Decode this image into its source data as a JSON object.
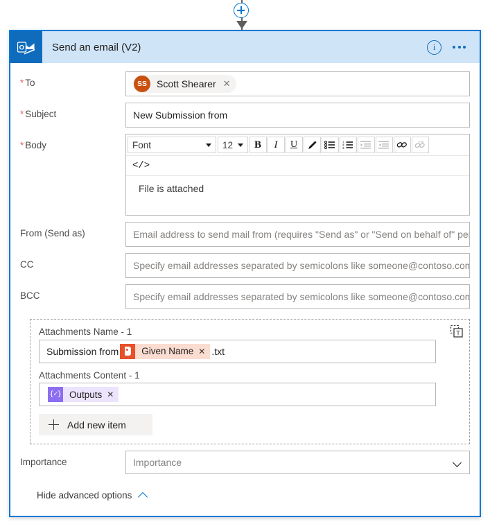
{
  "connector": {
    "add_step_icon": "plus-circle-icon",
    "arrow_icon": "arrow-down-icon"
  },
  "card": {
    "title": "Send an email (V2)",
    "app_icon": "outlook-icon",
    "info_icon": "i",
    "info_icon_name": "info-icon",
    "more_icon_name": "ellipsis-icon",
    "accent_color": "#0078d4",
    "header_bg": "#cfe4f7"
  },
  "fields": {
    "to": {
      "label": "To",
      "required": true,
      "person": {
        "initials": "SS",
        "name": "Scott Shearer",
        "avatar_color": "#ca5010",
        "remove_icon": "✕"
      }
    },
    "subject": {
      "label": "Subject",
      "required": true,
      "value": "New Submission from"
    },
    "body": {
      "label": "Body",
      "required": true,
      "content": "File is attached",
      "toolbar": {
        "font_label": "Font",
        "size_label": "12",
        "bold": "B",
        "italic": "I",
        "underline": "U",
        "text_color_icon": "pen-icon",
        "bulleted_list_icon": "bulleted-list-icon",
        "numbered_list_icon": "numbered-list-icon",
        "indent_decrease_icon": "indent-decrease-icon",
        "indent_increase_icon": "indent-increase-icon",
        "link_icon": "link-icon",
        "unlink_icon": "unlink-icon",
        "code_view": "</>"
      }
    },
    "from": {
      "label": "From (Send as)",
      "required": false,
      "placeholder": "Email address to send mail from (requires \"Send as\" or \"Send on behalf of\" permissions)"
    },
    "cc": {
      "label": "CC",
      "required": false,
      "placeholder": "Specify email addresses separated by semicolons like someone@contoso.com"
    },
    "bcc": {
      "label": "BCC",
      "required": false,
      "placeholder": "Specify email addresses separated by semicolons like someone@contoso.com"
    },
    "importance": {
      "label": "Importance",
      "placeholder": "Importance",
      "chevron_icon": "chevron-down-icon"
    }
  },
  "attachments": {
    "name_label": "Attachments Name - 1",
    "name_prefix": "Submission from",
    "name_token": {
      "label": "Given Name",
      "icon": "forms-icon",
      "icon_color": "#e8502a",
      "chip_color": "#fbdcd0",
      "remove_icon": "✕"
    },
    "name_suffix": ".txt",
    "content_label": "Attachments Content - 1",
    "content_token": {
      "label": "Outputs",
      "icon": "expression-icon",
      "icon_glyph": "{✓}",
      "icon_color": "#8c6ff0",
      "chip_color": "#ece4fd",
      "remove_icon": "✕"
    },
    "add_new_item_label": "Add new item",
    "delete_item_icon": "delete-item-icon"
  },
  "footer": {
    "advanced_options_label": "Hide advanced options",
    "chevron_icon": "chevron-up-icon"
  }
}
